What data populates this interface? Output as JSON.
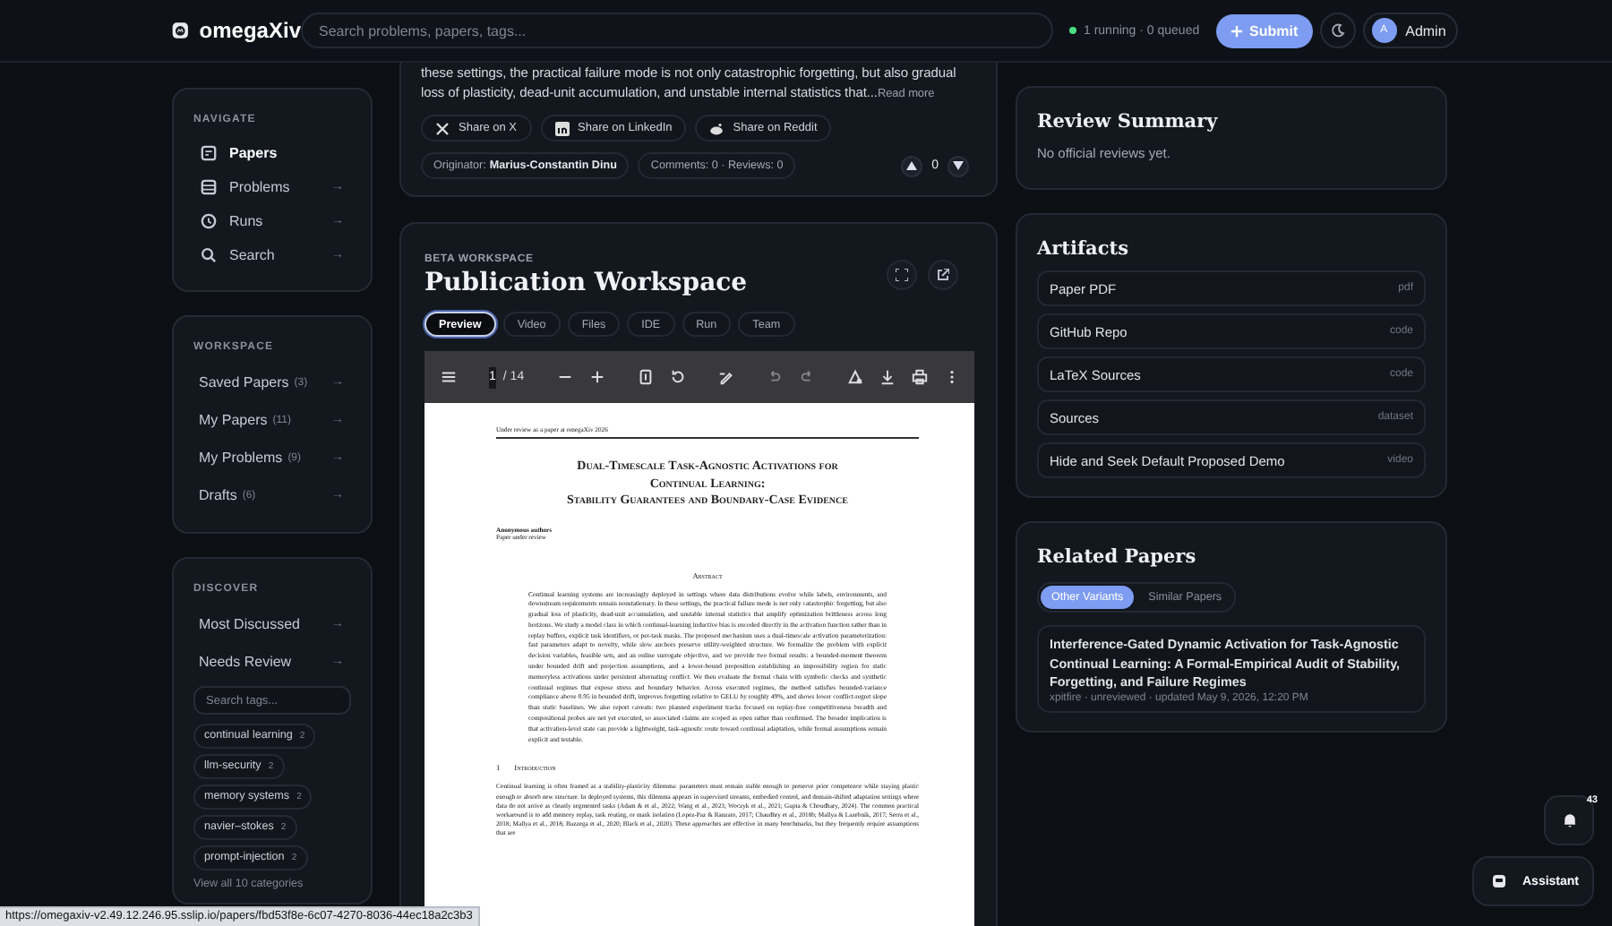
{
  "header": {
    "logo": "omegaXiv",
    "search_placeholder": "Search problems, papers, tags...",
    "queue_status": "1 running · 0 queued",
    "submit": "Submit",
    "user_initial": "A",
    "user_name": "Admin"
  },
  "sidebar": {
    "navigate": {
      "title": "NAVIGATE",
      "items": [
        {
          "label": "Papers",
          "selected": true
        },
        {
          "label": "Problems",
          "selected": false,
          "arrow": "→"
        },
        {
          "label": "Runs",
          "selected": false,
          "arrow": "→"
        },
        {
          "label": "Search",
          "selected": false,
          "arrow": "→"
        }
      ]
    },
    "workspace": {
      "title": "WORKSPACE",
      "items": [
        {
          "label": "Saved Papers",
          "count": "(3)",
          "arrow": "→"
        },
        {
          "label": "My Papers",
          "count": "(11)",
          "arrow": "→"
        },
        {
          "label": "My Problems",
          "count": "(9)",
          "arrow": "→"
        },
        {
          "label": "Drafts",
          "count": "(6)",
          "arrow": "→"
        }
      ]
    },
    "discover": {
      "title": "DISCOVER",
      "items": [
        {
          "label": "Most Discussed",
          "arrow": "→"
        },
        {
          "label": "Needs Review",
          "arrow": "→"
        }
      ],
      "tag_search_placeholder": "Search tags...",
      "tags": [
        {
          "label": "continual learning",
          "count": "2"
        },
        {
          "label": "llm-security",
          "count": "2"
        },
        {
          "label": "memory systems",
          "count": "2"
        },
        {
          "label": "navier–stokes",
          "count": "2"
        },
        {
          "label": "prompt-injection",
          "count": "2"
        }
      ],
      "view_all": "View all 10 categories"
    }
  },
  "paper": {
    "abstract_tail": "these settings, the practical failure mode is not only catastrophic forgetting, but also gradual loss of plasticity, dead-unit accumulation, and unstable internal statistics that...",
    "read_more": "Read more",
    "share": [
      {
        "kind": "x",
        "label": "Share on X"
      },
      {
        "kind": "linkedin",
        "label": "Share on LinkedIn"
      },
      {
        "kind": "reddit",
        "label": "Share on Reddit"
      }
    ],
    "originator_label": "Originator:",
    "originator": "Marius-Constantin Dinu",
    "stats": "Comments: 0 · Reviews: 0",
    "votes": "0"
  },
  "workspace": {
    "eyebrow": "BETA WORKSPACE",
    "title": "Publication Workspace",
    "tabs": [
      {
        "label": "Preview",
        "selected": true
      },
      {
        "label": "Video",
        "selected": false
      },
      {
        "label": "Files",
        "selected": false
      },
      {
        "label": "IDE",
        "selected": false
      },
      {
        "label": "Run",
        "selected": false
      },
      {
        "label": "Team",
        "selected": false
      }
    ],
    "pdf": {
      "page": "1",
      "total": "/ 14",
      "document": {
        "running_header": "Under review as a paper at omegaXiv 2026",
        "title_lines": [
          "Dual-Timescale Task-Agnostic Activations for",
          "Continual Learning:",
          "Stability Guarantees and Boundary-Case Evidence"
        ],
        "authors": "Anonymous authors",
        "affiliation": "Paper under review",
        "abstract_heading": "Abstract",
        "abstract": "Continual learning systems are increasingly deployed in settings where data distributions evolve while labels, environments, and downstream requirements remain nonstationary. In these settings, the practical failure mode is not only catastrophic forgetting, but also gradual loss of plasticity, dead-unit accumulation, and unstable internal statistics that amplify optimization brittleness across long horizons. We study a model class in which continual-learning inductive bias is encoded directly in the activation function rather than in replay buffers, explicit task identifiers, or per-task masks. The proposed mechanism uses a dual-timescale activation parameterization: fast parameters adapt to novelty, while slow anchors preserve utility-weighted structure. We formalize the problem with explicit decision variables, feasible sets, and an online surrogate objective, and we provide two formal results: a bounded-moment theorem under bounded drift and projection assumptions, and a lower-bound proposition establishing an impossibility region for static memoryless activations under persistent alternating conflict. We then evaluate the formal chain with symbolic checks and synthetic continual regimes that expose stress and boundary behavior. Across executed regimes, the method satisfies bounded-variance compliance above 0.95 in bounded drift, improves forgetting relative to GELU by roughly 49%, and shows lower conflict-regret slope than static baselines. We also report caveats: two planned experiment tracks focused on replay-free competitiveness breadth and compositional probes are not yet executed, so associated claims are scoped as open rather than confirmed. The broader implication is that activation-level state can provide a lightweight, task-agnostic route toward continual adaptation, while formal assumptions remain explicit and testable.",
        "section_number": "1",
        "section_title": "Introduction",
        "intro": "Continual learning is often framed as a stability-plasticity dilemma: parameters must remain stable enough to preserve prior competence while staying plastic enough to absorb new structure. In deployed systems, this dilemma appears in supervised streams, embodied control, and domain-shifted adaptation settings where data do not arrive as cleanly segmented tasks (Adam & et al., 2022; Wang et al., 2023; Woczyk et al., 2021; Gupta & Choudhary, 2024). The common practical workaround is to add memory replay, task routing, or mask isolation (Lopez-Paz & Ranzato, 2017; Chaudhry et al., 2018b; Mallya & Lazebnik, 2017; Serra et al., 2018; Mallya et al., 2018; Buzzega et al., 2020; Black et al., 2020). These approaches are effective in many benchmarks, but they frequently require assumptions that are"
      }
    }
  },
  "right": {
    "review_summary": {
      "title": "Review Summary",
      "text": "No official reviews yet."
    },
    "artifacts": {
      "title": "Artifacts",
      "items": [
        {
          "name": "Paper PDF",
          "type": "pdf"
        },
        {
          "name": "GitHub Repo",
          "type": "code"
        },
        {
          "name": "LaTeX Sources",
          "type": "code"
        },
        {
          "name": "Sources",
          "type": "dataset"
        },
        {
          "name": "Hide and Seek Default Proposed Demo",
          "type": "video"
        }
      ]
    },
    "related": {
      "title": "Related Papers",
      "tabs": [
        {
          "label": "Other Variants",
          "selected": true
        },
        {
          "label": "Similar Papers",
          "selected": false
        }
      ],
      "papers": [
        {
          "title": "Interference-Gated Dynamic Activation for Task-Agnostic Continual Learning: A Formal-Empirical Audit of Stability, Forgetting, and Failure Regimes",
          "meta": "xpitfire · unreviewed · updated May 9, 2026, 12:20 PM"
        }
      ]
    }
  },
  "floating": {
    "notifications_count": "43",
    "assistant": "Assistant"
  },
  "status_url": "https://omegaxiv-v2.49.12.246.95.sslip.io/papers/fbd53f8e-6c07-4270-8036-44ec18a2c3b3"
}
